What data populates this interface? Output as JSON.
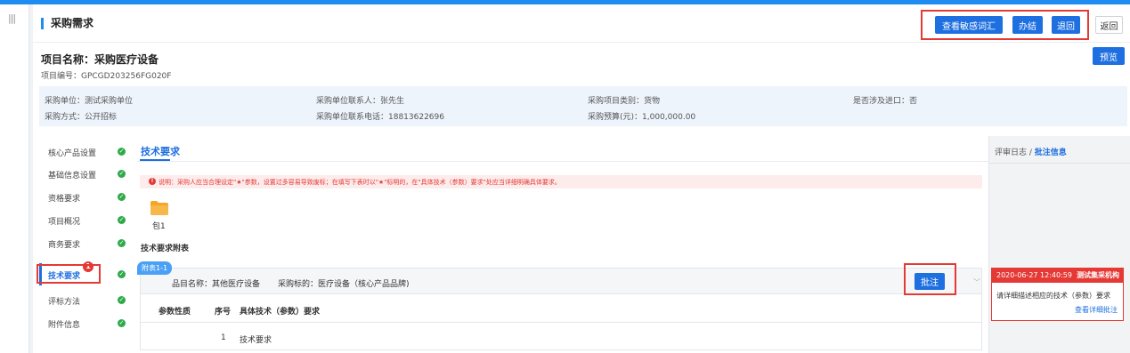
{
  "header": {
    "title": "采购需求",
    "buttons": {
      "sensitive_words": "查看敏感词汇",
      "finish": "办结",
      "return_back": "退回",
      "back": "返回",
      "preview": "预览"
    }
  },
  "project": {
    "name": "项目名称：采购医疗设备",
    "code": "项目编号：GPCGD203256FG020F"
  },
  "info": {
    "unit": "采购单位：测试采购单位",
    "contact": "采购单位联系人：张先生",
    "category": "采购项目类别：货物",
    "import": "是否涉及进口：否",
    "method": "采购方式：公开招标",
    "phone": "采购单位联系电话：18813622696",
    "budget": "采购预算(元)：1,000,000.00"
  },
  "sidebar": {
    "items": [
      {
        "label": "核心产品设置"
      },
      {
        "label": "基础信息设置"
      },
      {
        "label": "资格要求"
      },
      {
        "label": "项目概况"
      },
      {
        "label": "商务要求"
      },
      {
        "label": "技术要求",
        "badge": "1"
      },
      {
        "label": "评标方法"
      },
      {
        "label": "附件信息"
      }
    ]
  },
  "content": {
    "section_title": "技术要求",
    "note": "说明：采购人应当合理设定\"★\"参数，设置过多容易导致废标；在填写下表时以\"★\"标明的，在\"具体技术（参数）要求\"处应当详细明确具体要求。",
    "folder_label": "包1",
    "appendix_title": "技术要求附表",
    "table": {
      "tag": "附表1-1",
      "item_name": "品目名称：其他医疗设备",
      "target": "采购标的：医疗设备（核心产品品牌)",
      "annotate_button": "批注",
      "columns": [
        "参数性质",
        "序号",
        "具体技术（参数）要求"
      ],
      "rows": [
        {
          "nature": "",
          "seq": "1",
          "requirement": "技术要求"
        }
      ]
    }
  },
  "right_panel": {
    "title_prefix": "评审日志 / ",
    "title_active": "批注信息",
    "comment": {
      "time": "2020-06-27 12:40:59",
      "org": "测试集采机构",
      "text": "请详细描述相应的技术（参数）要求",
      "link": "查看详细批注"
    }
  },
  "colors": {
    "accent": "#1e6fe0",
    "danger": "#e53935",
    "success": "#2eaa4a",
    "folder": "#f5a623"
  }
}
